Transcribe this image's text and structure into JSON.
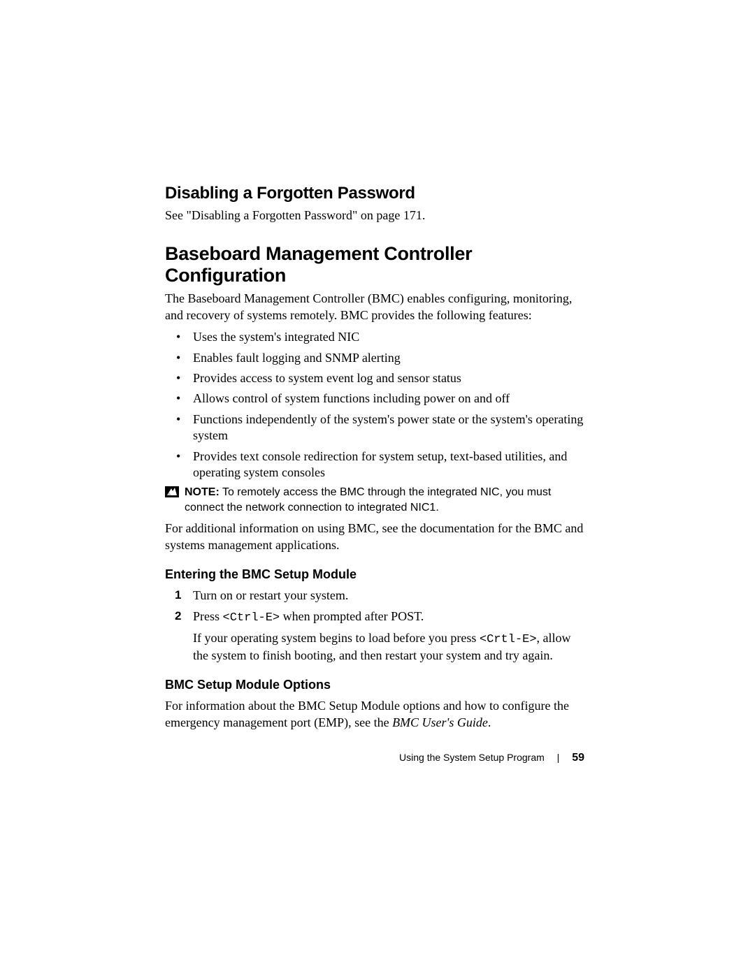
{
  "section1": {
    "heading": "Disabling a Forgotten Password",
    "body": "See \"Disabling a Forgotten Password\" on page 171."
  },
  "section2": {
    "heading": "Baseboard Management Controller Configuration",
    "intro": "The Baseboard Management Controller (BMC) enables configuring, monitoring, and recovery of systems remotely. BMC provides the following features:",
    "bullets": [
      "Uses the system's integrated NIC",
      "Enables fault logging and SNMP alerting",
      "Provides access to system event log and sensor status",
      "Allows control of system functions including power on and off",
      "Functions independently of the system's power state or the system's operating system",
      "Provides text console redirection for system setup, text-based utilities, and operating system consoles"
    ],
    "note_label": "NOTE:",
    "note_text": " To remotely access the BMC through the integrated NIC, you must connect the network connection to integrated NIC1.",
    "post_note": "For additional information on using BMC, see the documentation for the BMC and systems management applications."
  },
  "section3": {
    "heading": "Entering the BMC Setup Module",
    "step1": "Turn on or restart your system.",
    "step2_pre": "Press ",
    "step2_code": "<Ctrl-E>",
    "step2_post": " when prompted after POST.",
    "step2_extra_pre": "If your operating system begins to load before you press ",
    "step2_extra_code": "<Crtl-E>",
    "step2_extra_post": ", allow the system to finish booting, and then restart your system and try again."
  },
  "section4": {
    "heading": "BMC Setup Module Options",
    "body_pre": "For information about the BMC Setup Module options and how to configure the emergency management port (EMP), see the ",
    "body_italic": "BMC User's Guide",
    "body_post": "."
  },
  "footer": {
    "title": "Using the System Setup Program",
    "page": "59"
  }
}
